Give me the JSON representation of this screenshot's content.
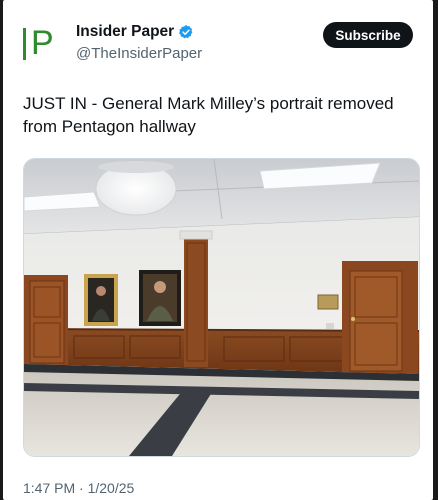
{
  "tweet": {
    "author_name": "Insider Paper",
    "author_handle": "@TheInsiderPaper",
    "logo_text": "IP",
    "subscribe_label": "Subscribe",
    "text": "JUST IN - General Mark Milley’s portrait removed from Pentagon hallway",
    "timestamp": "1:47 PM · 1/20/25"
  },
  "icons": {
    "verified": "verified-badge-icon",
    "logo": "insider-paper-logo"
  },
  "colors": {
    "brand_green": "#2e8b2e",
    "verified_blue": "#1d9bf0",
    "subscribe_bg": "#0f1419",
    "text_primary": "#0f1419",
    "text_secondary": "#536471"
  }
}
